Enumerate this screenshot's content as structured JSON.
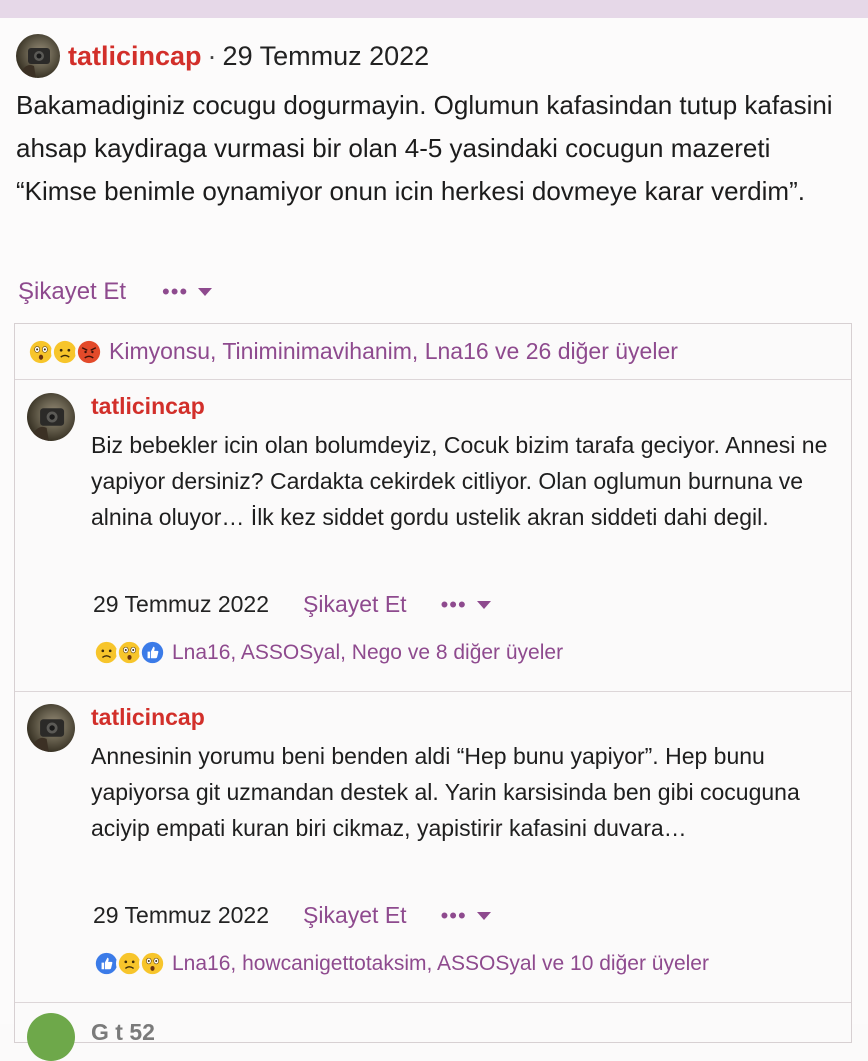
{
  "post": {
    "username": "tatlicincap",
    "separator": "·",
    "date": "29 Temmuz 2022",
    "body": "Bakamadiginiz cocugu dogurmayin. Oglumun kafasindan tutup kafasini ahsap kaydiraga vurmasi bir olan 4-5 yasindaki cocugun mazereti “Kimse benimle oynamiyor onun icin herkesi dovmeye karar verdim”.",
    "report_label": "Şikayet Et",
    "more_label": "•••",
    "reactions": {
      "icons": [
        "astonished-emoji",
        "sad-emoji",
        "angry-emoji"
      ],
      "text": "Kimyonsu, Tiniminimavihanim, Lna16 ve 26 diğer üyeler"
    }
  },
  "comments": [
    {
      "username": "tatlicincap",
      "body": "Biz bebekler icin olan bolumdeyiz, Cocuk bizim tarafa geciyor. Annesi ne yapiyor dersiniz? Cardakta cekirdek citliyor. Olan oglumun burnuna ve alnina oluyor… İlk kez siddet gordu ustelik akran siddeti dahi degil.",
      "date": "29 Temmuz 2022",
      "report_label": "Şikayet Et",
      "more_label": "•••",
      "reactions": {
        "icons": [
          "sad-emoji",
          "astonished-emoji",
          "like-emoji"
        ],
        "text": "Lna16, ASSOSyal, Nego ve 8 diğer üyeler"
      }
    },
    {
      "username": "tatlicincap",
      "body": "Annesinin yorumu beni benden aldi “Hep bunu yapiyor”. Hep bunu yapiyorsa git uzmandan destek al. Yarin karsisinda ben gibi cocuguna aciyip empati kuran biri cikmaz, yapistirir kafasini duvara…",
      "date": "29 Temmuz 2022",
      "report_label": "Şikayet Et",
      "more_label": "•••",
      "reactions": {
        "icons": [
          "like-emoji",
          "sad-emoji",
          "astonished-emoji"
        ],
        "text": "Lna16, howcanigettotaksim, ASSOSyal ve 10 diğer üyeler"
      }
    }
  ],
  "next_comment": {
    "username_partial": "G   t 52"
  },
  "colors": {
    "username": "#d22f2a",
    "link": "#8e4a8e",
    "topbar": "#e6d8e8",
    "border": "#d7d0d2"
  }
}
